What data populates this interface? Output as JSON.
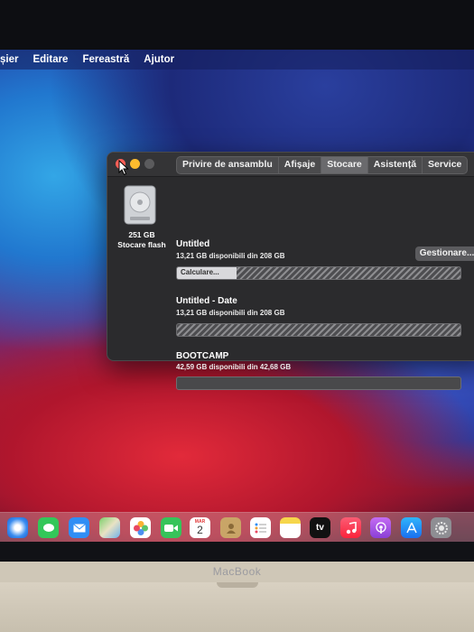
{
  "menubar": {
    "items": [
      "șier",
      "Editare",
      "Fereastră",
      "Ajutor"
    ]
  },
  "window": {
    "tabs": [
      "Privire de ansamblu",
      "Afișaje",
      "Stocare",
      "Asistență",
      "Service"
    ],
    "active_tab": "Stocare",
    "disk": {
      "size": "251 GB",
      "kind": "Stocare flash"
    },
    "manage_button": "Gestionare...",
    "volumes": [
      {
        "name": "Untitled",
        "available": "13,21 GB disponibili din 208 GB",
        "bar_label": "Calculare...",
        "fill_fraction": 0.21
      },
      {
        "name": "Untitled - Date",
        "available": "13,21 GB disponibili din 208 GB"
      },
      {
        "name": "BOOTCAMP",
        "available": "42,59 GB disponibili din 42,68 GB"
      }
    ]
  },
  "dock": {
    "calendar_month": "MAR",
    "calendar_day": "2",
    "tv_label": "tv",
    "icons": [
      "safari-icon",
      "messages-icon",
      "mail-icon",
      "maps-icon",
      "photos-icon",
      "facetime-icon",
      "calendar-icon",
      "contacts-icon",
      "reminders-icon",
      "notes-icon",
      "apple-tv-icon",
      "music-icon",
      "podcasts-icon",
      "app-store-icon",
      "system-preferences-icon"
    ]
  },
  "brand": "MacBook"
}
